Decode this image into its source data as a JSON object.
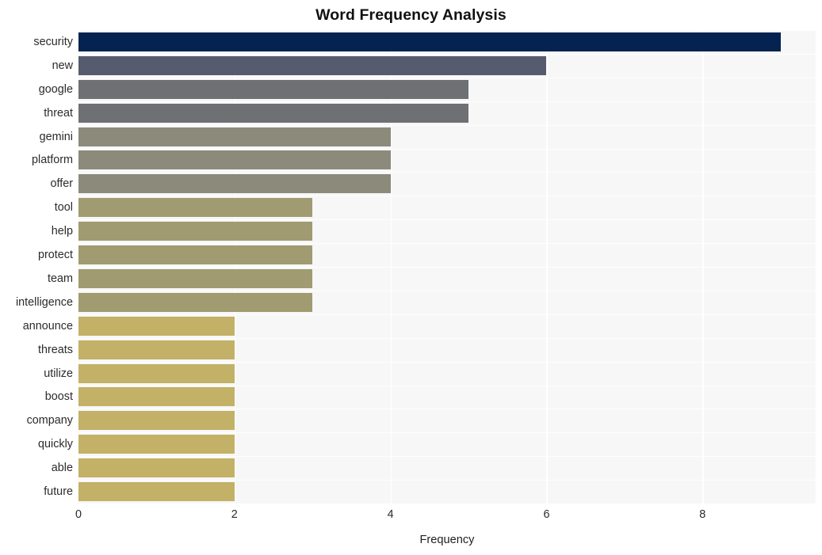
{
  "chart_data": {
    "type": "bar",
    "orientation": "horizontal",
    "title": "Word Frequency Analysis",
    "xlabel": "Frequency",
    "ylabel": "",
    "xlim": [
      0,
      9.45
    ],
    "ylim": [
      0,
      20
    ],
    "xticks": [
      "0",
      "2",
      "4",
      "6",
      "8"
    ],
    "xtick_values": [
      0,
      2,
      4,
      6,
      8
    ],
    "grid": "both-white-on-light-gray",
    "legend": "none",
    "categories": [
      "security",
      "new",
      "google",
      "threat",
      "gemini",
      "platform",
      "offer",
      "tool",
      "help",
      "protect",
      "team",
      "intelligence",
      "announce",
      "threats",
      "utilize",
      "boost",
      "company",
      "quickly",
      "able",
      "future"
    ],
    "values": [
      9,
      6,
      5,
      5,
      4,
      4,
      4,
      3,
      3,
      3,
      3,
      3,
      2,
      2,
      2,
      2,
      2,
      2,
      2,
      2
    ],
    "bar_colors": [
      "#042350",
      "#565b6e",
      "#6e7073",
      "#6e7073",
      "#8c8a7b",
      "#8c8a7b",
      "#8c8a7b",
      "#a09b70",
      "#a09b70",
      "#a09b70",
      "#a09b70",
      "#a09b70",
      "#c2b167",
      "#c2b167",
      "#c2b167",
      "#c2b167",
      "#c2b167",
      "#c2b167",
      "#c2b167",
      "#c2b167"
    ]
  },
  "style": {
    "page_background": "#ffffff",
    "plot_background": "#f7f7f8",
    "grid_color": "#ffffff",
    "text_color": "#2b2b2b",
    "title_color": "#111111"
  }
}
